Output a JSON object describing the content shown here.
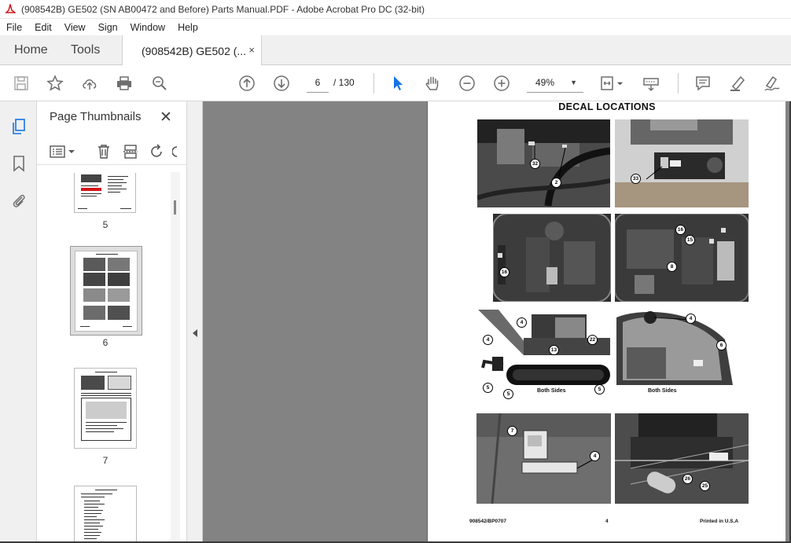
{
  "window": {
    "title": "(908542B) GE502 (SN AB00472 and Before) Parts Manual.PDF - Adobe Acrobat Pro DC (32-bit)"
  },
  "menu": [
    "File",
    "Edit",
    "View",
    "Sign",
    "Window",
    "Help"
  ],
  "tabs": {
    "home": "Home",
    "tools": "Tools",
    "doc": "(908542B) GE502 (...",
    "close": "×"
  },
  "toolbar": {
    "page_current": "6",
    "page_total": "/ 130",
    "zoom": "49%"
  },
  "thumbnails": {
    "title": "Page Thumbnails",
    "close": "✕",
    "pages": [
      "5",
      "6",
      "7"
    ]
  },
  "document": {
    "heading": "DECAL LOCATIONS",
    "captions": [
      "Both Sides",
      "Both Sides"
    ],
    "callouts": [
      "32",
      "2",
      "33",
      "16",
      "16",
      "15",
      "8",
      "4",
      "22",
      "13",
      "4",
      "5",
      "5",
      "5",
      "4",
      "6",
      "7",
      "4",
      "26",
      "25"
    ],
    "footer_left": "908542/BP0707",
    "footer_mid": "4",
    "footer_right": "Printed in U.S.A"
  },
  "colors": {
    "acrobat_red": "#d7141a",
    "workspace_gray": "#838383",
    "tool_blue": "#1473e6",
    "icon_gray": "#6e6e6e"
  }
}
